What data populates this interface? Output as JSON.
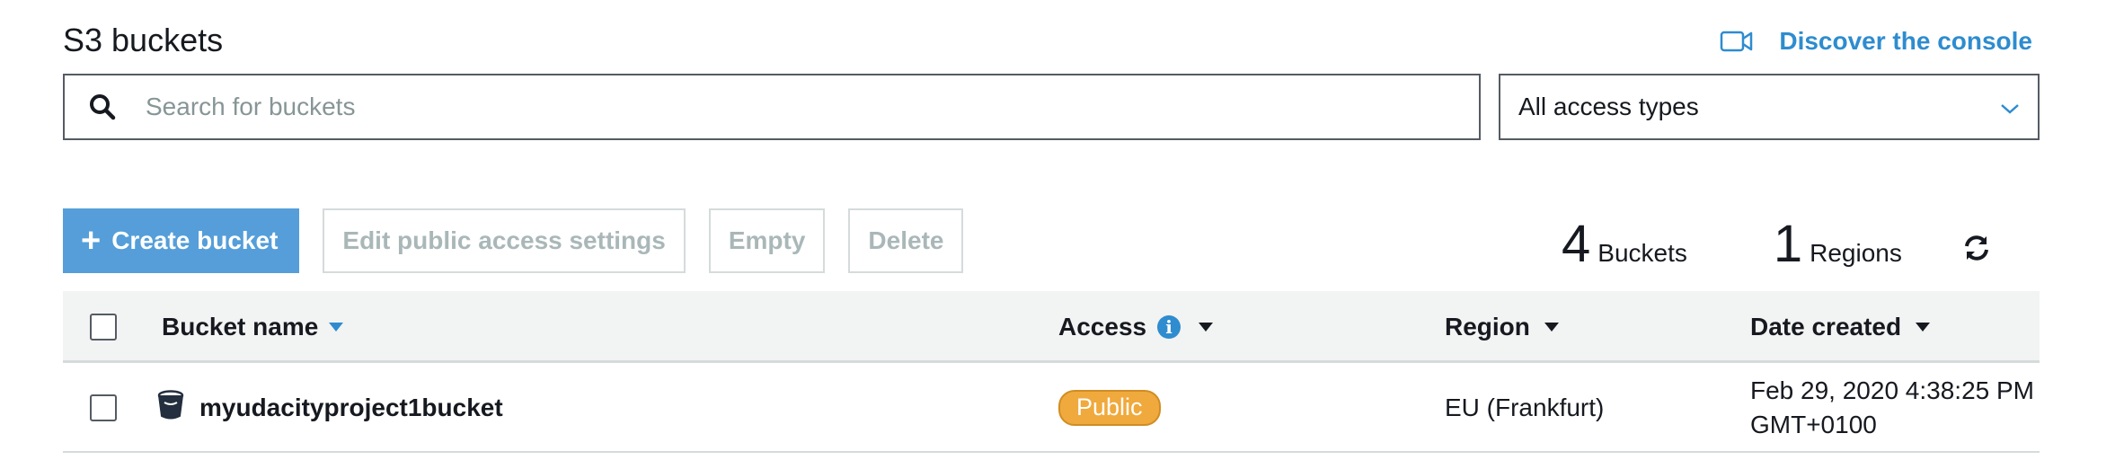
{
  "header": {
    "title": "S3 buckets",
    "discover_label": "Discover the console",
    "discover_icon": "video-camera-icon"
  },
  "search": {
    "placeholder": "Search for buckets",
    "value": "",
    "icon": "search-icon"
  },
  "filter": {
    "selected": "All access types",
    "icon": "chevron-down-icon"
  },
  "toolbar": {
    "create_label": "Create bucket",
    "edit_label": "Edit public access settings",
    "empty_label": "Empty",
    "delete_label": "Delete"
  },
  "summary": {
    "buckets_count": "4",
    "buckets_label": "Buckets",
    "regions_count": "1",
    "regions_label": "Regions",
    "refresh_icon": "refresh-icon"
  },
  "table": {
    "columns": [
      {
        "label": "Bucket name"
      },
      {
        "label": "Access"
      },
      {
        "label": "Region"
      },
      {
        "label": "Date created"
      }
    ],
    "rows": [
      {
        "name": "myudacityproject1bucket",
        "icon": "bucket-icon",
        "access": "Public",
        "region": "EU (Frankfurt)",
        "date_line1": "Feb 29, 2020 4:38:25 PM",
        "date_line2": "GMT+0100"
      }
    ]
  },
  "colors": {
    "accent": "#2e8ccf",
    "primary_button": "#559ed9",
    "public_badge": "#f0a93c",
    "disabled_text": "#aab7b8"
  }
}
